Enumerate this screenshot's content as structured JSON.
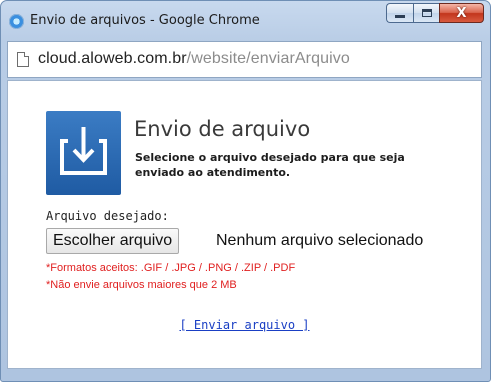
{
  "window": {
    "title": "Envio de arquivos - Google Chrome",
    "controls": {
      "minimize": "",
      "maximize": "",
      "close": "X"
    }
  },
  "address_bar": {
    "host": "cloud.aloweb.com.br",
    "path": "/website/enviarArquivo"
  },
  "upload": {
    "heading": "Envio de arquivo",
    "description": "Selecione o arquivo desejado para que seja enviado ao atendimento.",
    "field_label": "Arquivo desejado:",
    "choose_button": "Escolher arquivo",
    "no_file_text": "Nenhum arquivo selecionado",
    "formats_note": "*Formatos aceitos: .GIF / .JPG / .PNG / .ZIP / .PDF",
    "size_note": "*Não envie arquivos maiores que 2 MB",
    "submit_link": "[ Enviar arquivo ]"
  },
  "colors": {
    "accent_blue": "#1f5ba3",
    "note_red": "#e02020",
    "link_blue": "#1a3fc4"
  },
  "icons": {
    "browser": "chrome-icon",
    "page": "page-icon",
    "upload": "upload-tray-icon"
  }
}
